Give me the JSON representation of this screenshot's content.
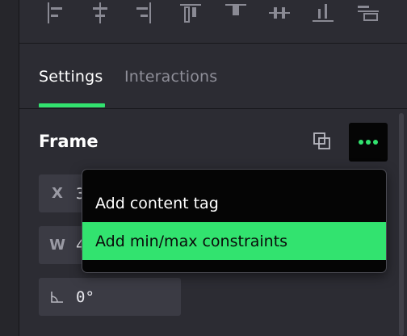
{
  "colors": {
    "accent": "#32e36f",
    "panel_bg": "#2c2c33",
    "field_bg": "#3b3b44",
    "menu_bg": "#050505",
    "muted_text": "#8f8f99"
  },
  "toolbar": {
    "icons": [
      "align-left-icon",
      "align-horizontal-center-icon",
      "align-right-icon",
      "align-top-icon",
      "align-vertical-center-icon",
      "distribute-horizontal-icon",
      "align-bottom-icon",
      "distribute-vertical-icon"
    ]
  },
  "tabs": [
    {
      "label": "Settings",
      "active": true
    },
    {
      "label": "Interactions",
      "active": false
    }
  ],
  "frame": {
    "title": "Frame",
    "copy_icon": "duplicate-icon",
    "more_icon": "more-horizontal-icon",
    "x": {
      "label": "X",
      "value": "3"
    },
    "w": {
      "label": "W",
      "value": "4"
    },
    "rotation": {
      "icon": "angle-icon",
      "value": "0°"
    }
  },
  "menu": {
    "items": [
      {
        "label": "Add content tag",
        "highlighted": false
      },
      {
        "label": "Add min/max constraints",
        "highlighted": true
      }
    ]
  }
}
